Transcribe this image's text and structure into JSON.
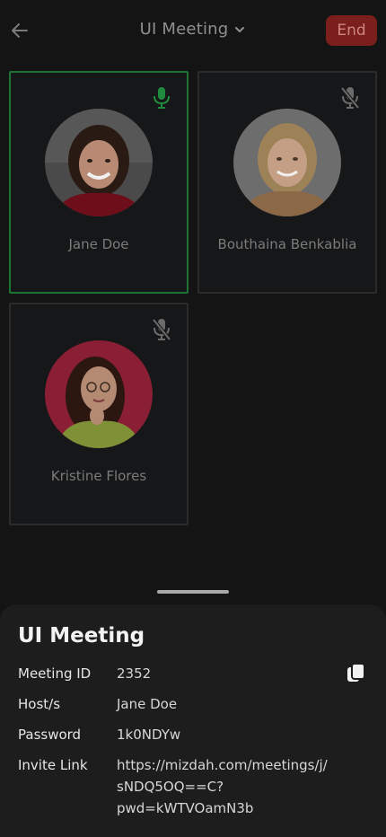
{
  "header": {
    "title": "UI Meeting",
    "end_label": "End"
  },
  "participants": [
    {
      "name": "Jane Doe",
      "mic": "on",
      "active": true
    },
    {
      "name": "Bouthaina Benkablia",
      "mic": "muted",
      "active": false
    },
    {
      "name": "Kristine Flores",
      "mic": "muted",
      "active": false
    }
  ],
  "colors": {
    "active_border": "#1d7434",
    "mic_on": "#1f8a3d",
    "end_button": "#7a1f1c"
  },
  "details": {
    "title": "UI Meeting",
    "meeting_id_label": "Meeting ID",
    "meeting_id": "2352",
    "host_label": "Host/s",
    "host": "Jane Doe",
    "password_label": "Password",
    "password": "1k0NDYw",
    "invite_label": "Invite Link",
    "invite_line1": "https://mizdah.com/meetings/j/",
    "invite_line2": "sNDQ5OQ==C?",
    "invite_line3": "pwd=kWTVOamN3b"
  }
}
